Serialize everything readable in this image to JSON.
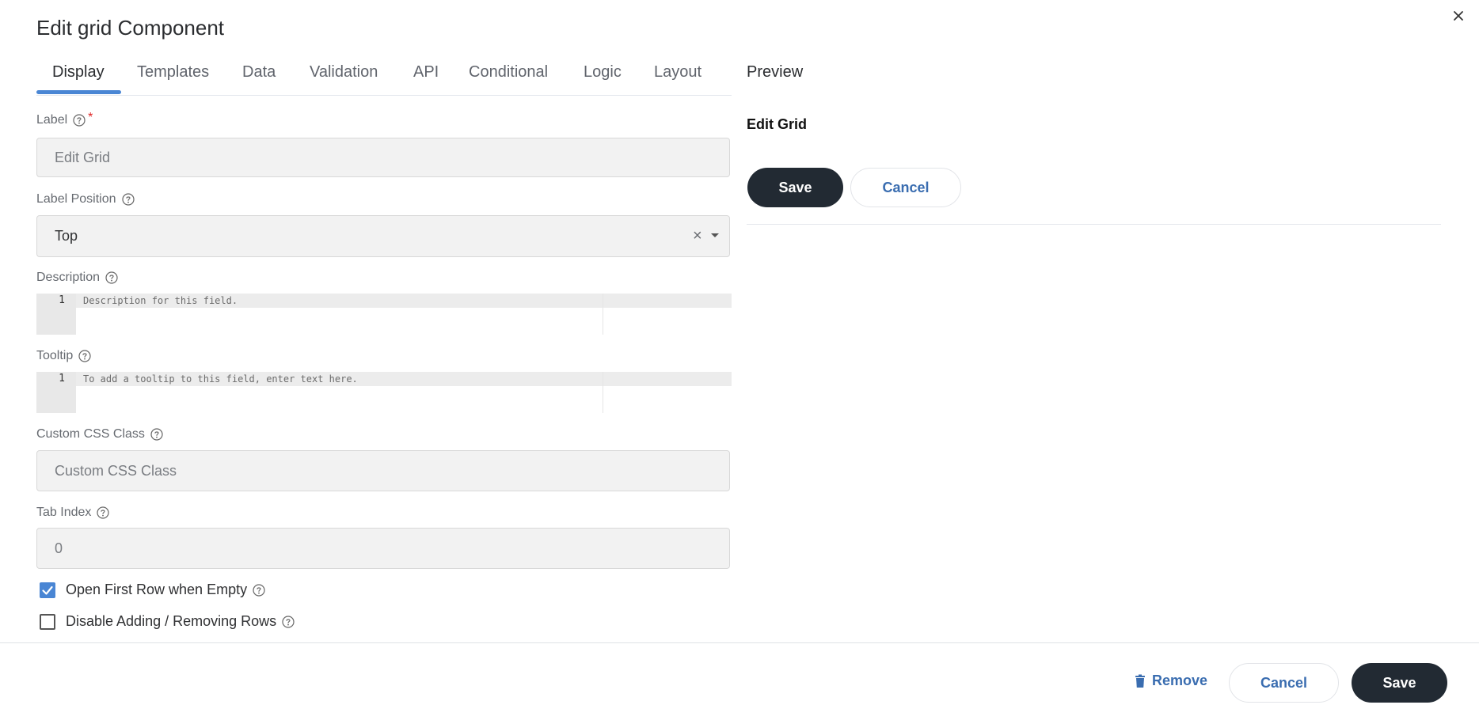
{
  "dialog": {
    "title": "Edit grid Component",
    "close_icon": "close-icon"
  },
  "tabs": [
    {
      "label": "Display",
      "active": true
    },
    {
      "label": "Templates"
    },
    {
      "label": "Data"
    },
    {
      "label": "Validation"
    },
    {
      "label": "API"
    },
    {
      "label": "Conditional"
    },
    {
      "label": "Logic"
    },
    {
      "label": "Layout"
    }
  ],
  "form": {
    "label": {
      "title": "Label",
      "required_mark": "*",
      "value": "Edit Grid"
    },
    "label_position": {
      "title": "Label Position",
      "value": "Top",
      "clear_glyph": "×"
    },
    "description": {
      "title": "Description",
      "line_number": "1",
      "placeholder": "Description for this field."
    },
    "tooltip": {
      "title": "Tooltip",
      "line_number": "1",
      "placeholder": "To add a tooltip to this field, enter text here."
    },
    "custom_css": {
      "title": "Custom CSS Class",
      "placeholder": "Custom CSS Class"
    },
    "tab_index": {
      "title": "Tab Index",
      "placeholder": "0"
    },
    "open_first_row": {
      "label": "Open First Row when Empty",
      "checked": true
    },
    "disable_adding": {
      "label": "Disable Adding / Removing Rows",
      "checked": false
    }
  },
  "preview": {
    "title": "Preview",
    "component_label": "Edit Grid",
    "save_label": "Save",
    "cancel_label": "Cancel"
  },
  "footer": {
    "remove_label": "Remove",
    "cancel_label": "Cancel",
    "save_label": "Save"
  },
  "colors": {
    "accent": "#4a86d4",
    "dark_button": "#222a33",
    "link": "#3a6db0",
    "required": "#e02424"
  }
}
